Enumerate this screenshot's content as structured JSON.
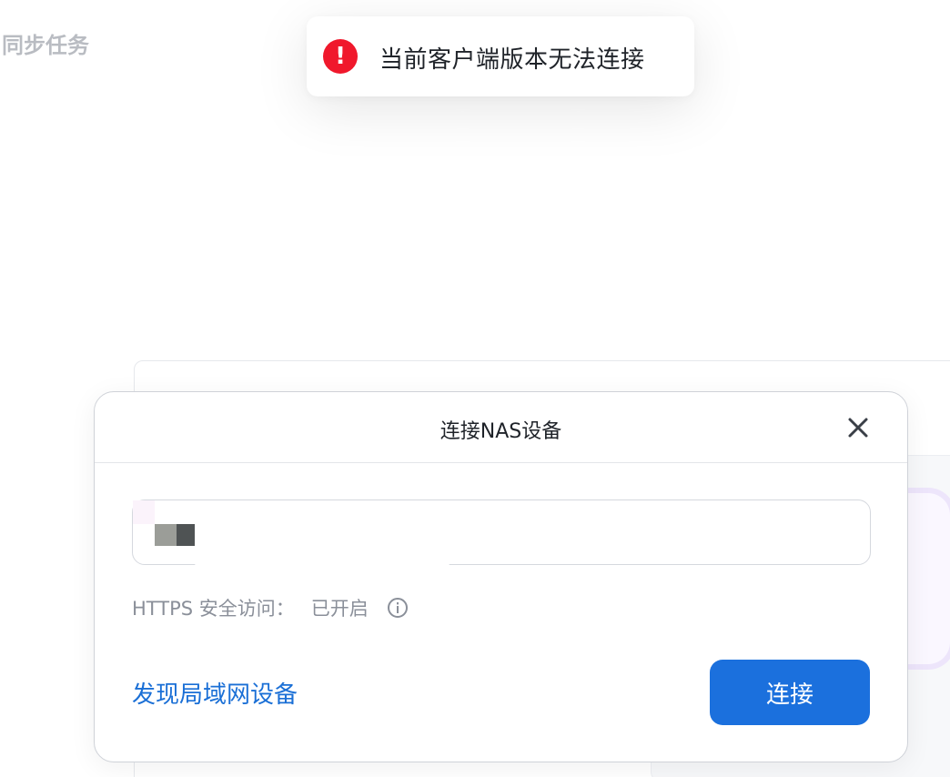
{
  "page": {
    "heading": "同步任务"
  },
  "toast": {
    "icon": "exclamation-circle-icon",
    "icon_glyph": "!",
    "message": "当前客户端版本无法连接",
    "color": "#f0182c"
  },
  "dialog": {
    "title": "连接NAS设备",
    "close_icon": "close-icon",
    "address_input": {
      "mosaic_colors": [
        "#9b9d98",
        "#4f5354",
        "#d4d8dc",
        "#8f9195",
        "#727778",
        "#b7b3b7",
        "#e6e6e6",
        "#aeaaae",
        "#c1c5cb",
        "#dee2dd",
        "#e8e8e8"
      ]
    },
    "https": {
      "label": "HTTPS 安全访问：",
      "status": "已开启",
      "info_icon": "info-icon"
    },
    "discover_link": "发现局域网设备",
    "connect_button": "连接",
    "accent_color": "#1b70dd"
  }
}
